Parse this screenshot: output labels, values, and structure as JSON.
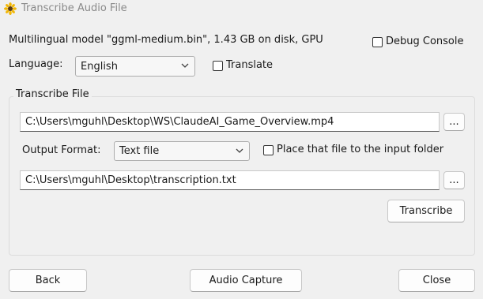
{
  "window": {
    "title": "Transcribe Audio File",
    "icon": "sunflower-icon"
  },
  "model_info": "Multilingual model \"ggml-medium.bin\", 1.43 GB on disk, GPU",
  "debug_console": {
    "label": "Debug Console",
    "checked": false
  },
  "language": {
    "label": "Language:",
    "value": "English"
  },
  "translate": {
    "label": "Translate",
    "checked": false
  },
  "transcribe_file": {
    "group_title": "Transcribe File",
    "input_path": "C:\\Users\\mguhl\\Desktop\\WS\\ClaudeAI_Game_Overview.mp4",
    "browse_label": "...",
    "output_format_label": "Output Format:",
    "output_format_value": "Text file",
    "place_in_input_folder": {
      "label": "Place that file to the input folder",
      "checked": false
    },
    "output_path": "C:\\Users\\mguhl\\Desktop\\transcription.txt",
    "browse_output_label": "...",
    "transcribe_label": "Transcribe"
  },
  "footer": {
    "back_label": "Back",
    "audio_capture_label": "Audio Capture",
    "close_label": "Close"
  }
}
